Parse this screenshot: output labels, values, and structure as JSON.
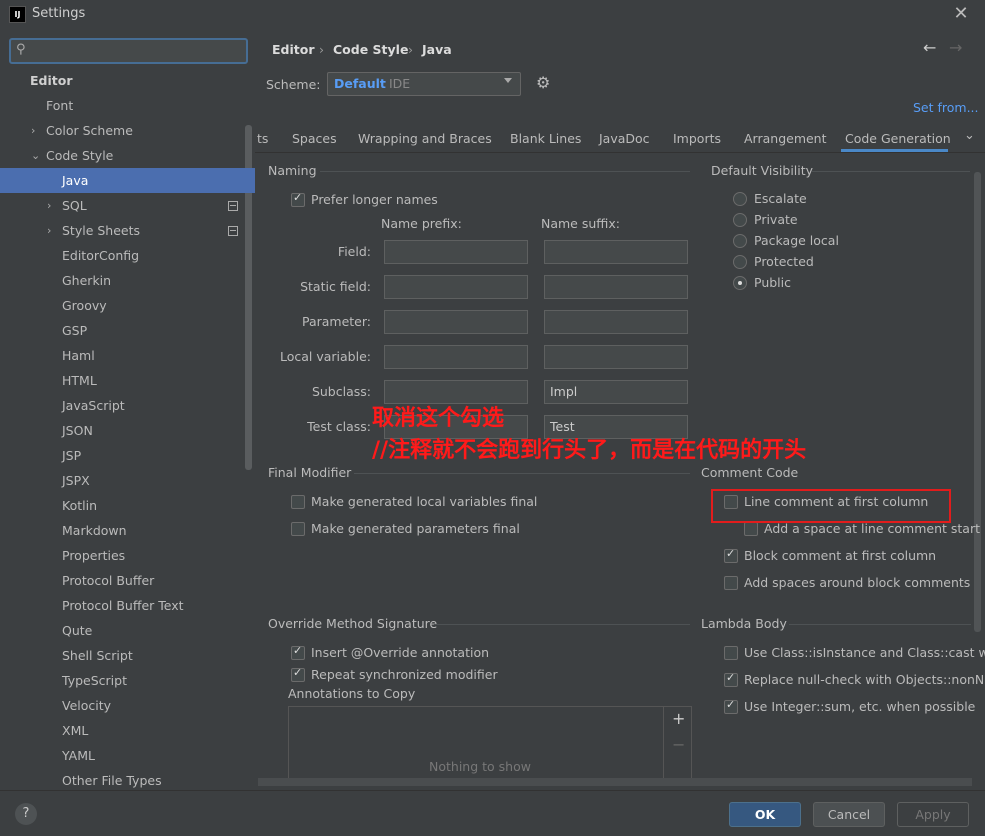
{
  "window": {
    "title": "Settings",
    "app_icon": "IJ",
    "close": "✕"
  },
  "sidebar": {
    "search": {
      "placeholder": "",
      "icon": "search-icon"
    },
    "items": [
      {
        "label": "Editor",
        "level": 0,
        "bold": true
      },
      {
        "label": "Font",
        "level": 1
      },
      {
        "label": "Color Scheme",
        "level": 1,
        "arrow": "›"
      },
      {
        "label": "Code Style",
        "level": 1,
        "arrow": "⌄"
      },
      {
        "label": "Java",
        "level": 2,
        "selected": true
      },
      {
        "label": "SQL",
        "level": 2,
        "arrow": "›",
        "mod": true
      },
      {
        "label": "Style Sheets",
        "level": 2,
        "arrow": "›",
        "mod": true
      },
      {
        "label": "EditorConfig",
        "level": 2
      },
      {
        "label": "Gherkin",
        "level": 2
      },
      {
        "label": "Groovy",
        "level": 2
      },
      {
        "label": "GSP",
        "level": 2
      },
      {
        "label": "Haml",
        "level": 2
      },
      {
        "label": "HTML",
        "level": 2
      },
      {
        "label": "JavaScript",
        "level": 2
      },
      {
        "label": "JSON",
        "level": 2
      },
      {
        "label": "JSP",
        "level": 2
      },
      {
        "label": "JSPX",
        "level": 2
      },
      {
        "label": "Kotlin",
        "level": 2
      },
      {
        "label": "Markdown",
        "level": 2
      },
      {
        "label": "Properties",
        "level": 2
      },
      {
        "label": "Protocol Buffer",
        "level": 2
      },
      {
        "label": "Protocol Buffer Text",
        "level": 2
      },
      {
        "label": "Qute",
        "level": 2
      },
      {
        "label": "Shell Script",
        "level": 2
      },
      {
        "label": "TypeScript",
        "level": 2
      },
      {
        "label": "Velocity",
        "level": 2
      },
      {
        "label": "XML",
        "level": 2
      },
      {
        "label": "YAML",
        "level": 2
      },
      {
        "label": "Other File Types",
        "level": 2
      }
    ]
  },
  "breadcrumb": [
    "Editor",
    "Code Style",
    "Java"
  ],
  "scheme": {
    "label": "Scheme:",
    "name": "Default",
    "type": "IDE",
    "set_from": "Set from..."
  },
  "tabs": [
    "ts",
    "Spaces",
    "Wrapping and Braces",
    "Blank Lines",
    "JavaDoc",
    "Imports",
    "Arrangement",
    "Code Generation"
  ],
  "active_tab": "Code Generation",
  "naming": {
    "title": "Naming",
    "prefer_longer": {
      "label": "Prefer longer names",
      "checked": true
    },
    "prefix_header": "Name prefix:",
    "suffix_header": "Name suffix:",
    "rows": [
      {
        "label": "Field:",
        "prefix": "",
        "suffix": ""
      },
      {
        "label": "Static field:",
        "prefix": "",
        "suffix": ""
      },
      {
        "label": "Parameter:",
        "prefix": "",
        "suffix": ""
      },
      {
        "label": "Local variable:",
        "prefix": "",
        "suffix": ""
      },
      {
        "label": "Subclass:",
        "prefix": "",
        "suffix": "Impl"
      },
      {
        "label": "Test class:",
        "prefix": "",
        "suffix": "Test"
      }
    ]
  },
  "default_visibility": {
    "title": "Default Visibility",
    "options": [
      "Escalate",
      "Private",
      "Package local",
      "Protected",
      "Public"
    ],
    "selected": "Public"
  },
  "final_modifier": {
    "title": "Final Modifier",
    "items": [
      {
        "label": "Make generated local variables final",
        "checked": false
      },
      {
        "label": "Make generated parameters final",
        "checked": false
      }
    ]
  },
  "comment_code": {
    "title": "Comment Code",
    "items": [
      {
        "label": "Line comment at first column",
        "checked": false
      },
      {
        "label": "Add a space at line comment start",
        "checked": false
      },
      {
        "label": "Block comment at first column",
        "checked": true
      },
      {
        "label": "Add spaces around block comments",
        "checked": false
      }
    ]
  },
  "override": {
    "title": "Override Method Signature",
    "items": [
      {
        "label": "Insert @Override annotation",
        "checked": true
      },
      {
        "label": "Repeat synchronized modifier",
        "checked": true
      }
    ],
    "annotations_label": "Annotations to Copy",
    "empty_text": "Nothing to show",
    "add": "+",
    "remove": "−"
  },
  "lambda": {
    "title": "Lambda Body",
    "items": [
      {
        "label": "Use Class::isInstance and Class::cast when",
        "checked": false
      },
      {
        "label": "Replace null-check with Objects::nonNull",
        "checked": true
      },
      {
        "label": "Use Integer::sum, etc. when possible",
        "checked": true
      }
    ]
  },
  "annotation_overlay": {
    "line1": "取消这个勾选",
    "line2": "//注释就不会跑到行头了，而是在代码的开头",
    "color": "#ff1a1a"
  },
  "buttons": {
    "help": "?",
    "ok": "OK",
    "cancel": "Cancel",
    "apply": "Apply"
  },
  "colors": {
    "accent": "#4b6eaf",
    "link": "#589df6",
    "background": "#3c3f41"
  }
}
